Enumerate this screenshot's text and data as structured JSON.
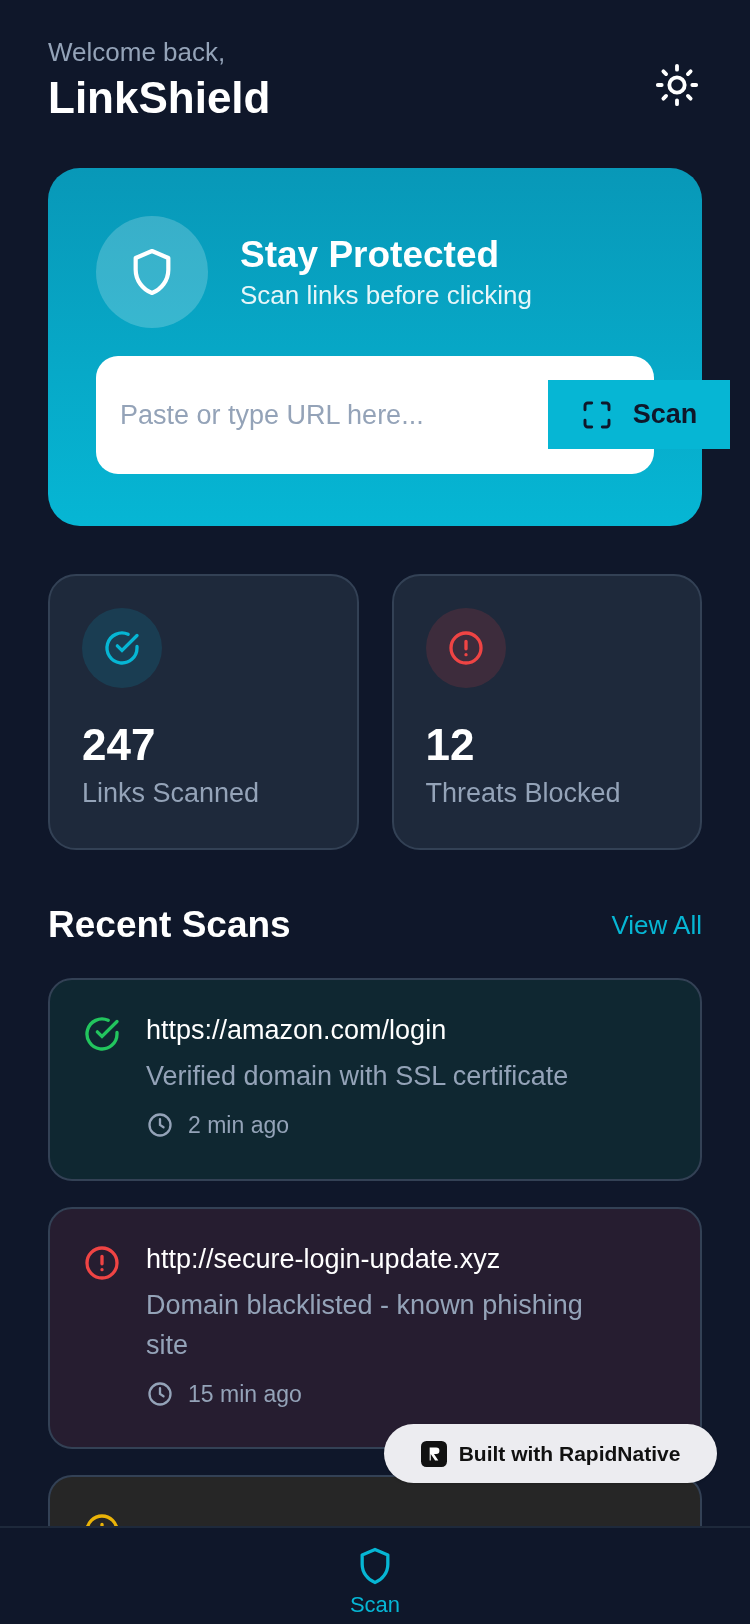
{
  "header": {
    "greeting": "Welcome back,",
    "app_name": "LinkShield"
  },
  "hero": {
    "title": "Stay Protected",
    "subtitle": "Scan links before clicking",
    "url_field": {
      "placeholder": "Paste or type URL here..."
    },
    "scan_button": "Scan"
  },
  "stats": [
    {
      "kind": "scanned",
      "value": "247",
      "label": "Links Scanned"
    },
    {
      "kind": "threats",
      "value": "12",
      "label": "Threats Blocked"
    }
  ],
  "recent": {
    "title": "Recent Scans",
    "view_all": "View All",
    "scans": [
      {
        "kind": "safe",
        "url": "https://amazon.com/login",
        "description": "Verified domain with SSL certificate",
        "time": "2 min ago"
      },
      {
        "kind": "danger",
        "url": "http://secure-login-update.xyz",
        "description": "Domain blacklisted - known phishing site",
        "time": "15 min ago"
      },
      {
        "kind": "warning"
      }
    ]
  },
  "nav": [
    {
      "label": "Scan",
      "selected": true
    }
  ],
  "badge": "Built with RapidNative"
}
